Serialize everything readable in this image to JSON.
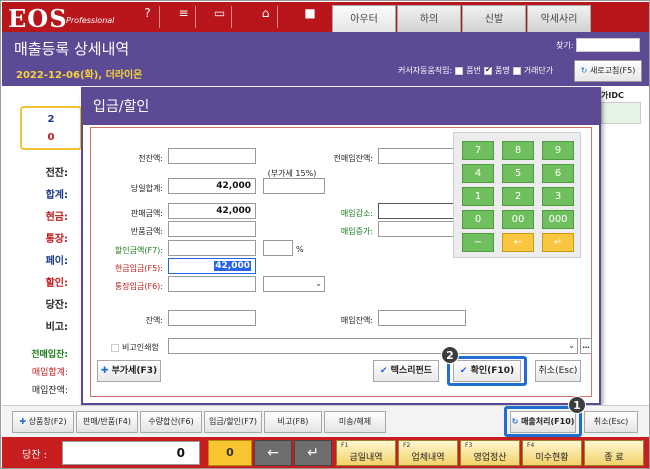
{
  "app": {
    "logo": "EOS",
    "logo_sub": "Professional",
    "top_tabs": [
      "아우터",
      "하의",
      "신발",
      "악세사리"
    ]
  },
  "header": {
    "title": "매출등록 상세내역",
    "subtitle": "2022-12-06(화), 더라이온",
    "search_label": "찾기:",
    "cursor_label": "커서자동움직임:",
    "options": [
      {
        "label": "품번",
        "checked": false
      },
      {
        "label": "품명",
        "checked": true
      },
      {
        "label": "거래단가",
        "checked": false
      }
    ],
    "refresh_button": "새로고침(F5)"
  },
  "left_panel": {
    "num1": "2",
    "num2": "0",
    "labels": [
      "전잔:",
      "합계:",
      "현금:",
      "통장:",
      "페이:",
      "할인:",
      "당잔:",
      "비고:"
    ],
    "lower_labels": [
      "전매입잔:",
      "매입합계:",
      "매입잔액:"
    ]
  },
  "right_panel": {
    "label": "가IDC"
  },
  "dialog": {
    "title": "입금/할인",
    "fields": {
      "prev_balance": {
        "label": "전잔액:",
        "value": ""
      },
      "prev_purchase_balance": {
        "label": "전매입잔액:",
        "value": ""
      },
      "vat_note": "(부가세 15%)",
      "today_total": {
        "label": "당일합계:",
        "value": "42,000"
      },
      "sales_amount": {
        "label": "판매금액:",
        "value": "42,000"
      },
      "purchase_decrease": {
        "label": "매입감소:",
        "value": ""
      },
      "return_amount": {
        "label": "반품금액:",
        "value": ""
      },
      "purchase_increase": {
        "label": "매입증가:",
        "value": ""
      },
      "discount_amount": {
        "label": "할인금액(F7):",
        "value": ""
      },
      "percent_sign": "%",
      "cash_deposit": {
        "label": "현금입금(F5):",
        "value": "42,000"
      },
      "bank_deposit": {
        "label": "통장입금(F6):",
        "value": ""
      },
      "balance": {
        "label": "잔액:",
        "value": ""
      },
      "purchase_balance": {
        "label": "매입잔액:",
        "value": ""
      },
      "hide_remark": {
        "label": "비고인쇄함",
        "checked": false
      }
    },
    "keypad": [
      "7",
      "8",
      "9",
      "4",
      "5",
      "6",
      "1",
      "2",
      "3",
      "0",
      "00",
      "000",
      "−",
      "←",
      "↵"
    ],
    "buttons": {
      "vat": "부가세(F3)",
      "text_refund": "텍스리펀드",
      "confirm": "확인(F10)",
      "cancel": "취소(Esc)"
    }
  },
  "bottom_toolbar": {
    "buttons": [
      "상품창(F2)",
      "판매/반품(F4)",
      "수량합산(F6)",
      "입금/할인(F7)",
      "비고(F8)",
      "미송/해제"
    ],
    "sales_process": "매출처리(F10)",
    "cancel": "취소(Esc)"
  },
  "footer": {
    "label": "당잔 :",
    "value": "0",
    "yellow_value": "0",
    "arrows": [
      "←",
      "↵"
    ],
    "buttons": [
      {
        "small": "F1",
        "label": "금일내역"
      },
      {
        "small": "F2",
        "label": "업체내역"
      },
      {
        "small": "F3",
        "label": "영업정산"
      },
      {
        "small": "F4",
        "label": "미수현황"
      },
      {
        "small": "",
        "label": "종 료"
      }
    ]
  },
  "markers": [
    "1",
    "2"
  ],
  "colors": {
    "app_red": "#b8161b",
    "header_purple": "#5d4a94",
    "keypad_green": "#6fbf5e",
    "keypad_yellow": "#f8c63f",
    "highlight_blue": "#1e6fd1"
  }
}
